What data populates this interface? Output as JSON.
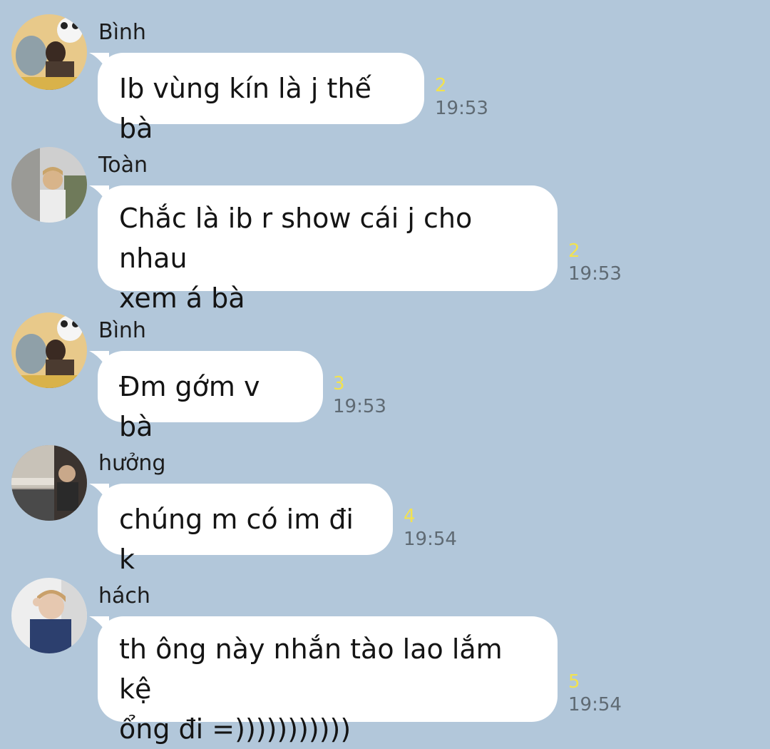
{
  "chat": {
    "messages": [
      {
        "sender": "Bình",
        "text": "Ib vùng kín là j thế bà",
        "read_count": "2",
        "time": "19:53",
        "avatar": "avatar-binh"
      },
      {
        "sender": "Toàn",
        "text": "Chắc là ib r show cái j cho nhau\nxem á bà",
        "read_count": "2",
        "time": "19:53",
        "avatar": "avatar-toan"
      },
      {
        "sender": "Bình",
        "text": "Đm gớm v bà",
        "read_count": "3",
        "time": "19:53",
        "avatar": "avatar-binh"
      },
      {
        "sender": "hưởng",
        "text": "chúng m có im đi k",
        "read_count": "4",
        "time": "19:54",
        "avatar": "avatar-huong"
      },
      {
        "sender": "hách",
        "text": "th ông này nhắn tào lao lắm kệ\nổng đi =)))))))))))",
        "read_count": "5",
        "time": "19:54",
        "avatar": "avatar-hach"
      }
    ]
  },
  "colors": {
    "background": "#b2c7da",
    "bubble": "#ffffff",
    "read_count": "#f2e24f",
    "time": "#5f6a73"
  }
}
